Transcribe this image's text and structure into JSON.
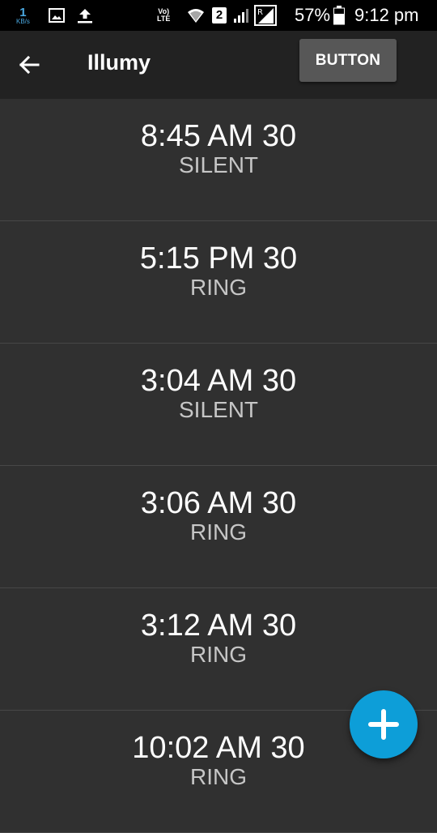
{
  "status_bar": {
    "net_speed_value": "1",
    "net_speed_unit": "KB/s",
    "volte_line1": "Vo)",
    "volte_line2": "LTE",
    "sim_slot": "2",
    "battery_percent": "57%",
    "time": "9:12 pm",
    "icons": [
      "gallery-icon",
      "upload-icon",
      "wifi-icon",
      "signal-icon",
      "roaming-icon",
      "battery-icon"
    ]
  },
  "toolbar": {
    "title": "Illumy",
    "button_label": "BUTTON",
    "back_icon": "arrow-left-icon"
  },
  "schedules": [
    {
      "time": "8:45 AM 30",
      "mode": "SILENT"
    },
    {
      "time": "5:15 PM 30",
      "mode": "RING"
    },
    {
      "time": "3:04 AM 30",
      "mode": "SILENT"
    },
    {
      "time": "3:06 AM 30",
      "mode": "RING"
    },
    {
      "time": "3:12 AM 30",
      "mode": "RING"
    },
    {
      "time": "10:02 AM 30",
      "mode": "RING"
    }
  ],
  "fab": {
    "icon": "plus-icon"
  },
  "colors": {
    "background": "#303030",
    "toolbar": "#222222",
    "status_bar": "#000000",
    "accent": "#0d9ed8",
    "divider": "#474747"
  }
}
